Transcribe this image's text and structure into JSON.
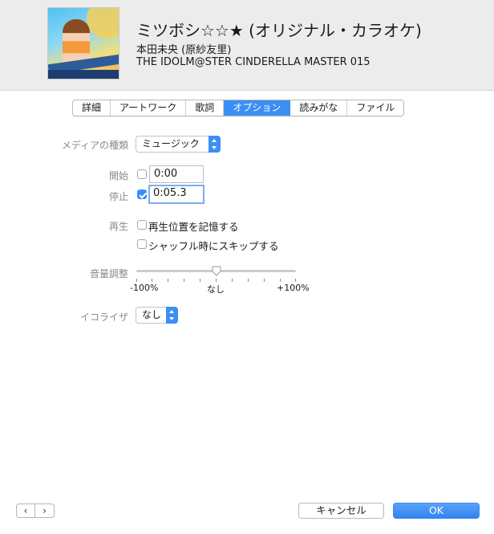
{
  "track": {
    "title": "ミツボシ☆☆★ (オリジナル・カラオケ)",
    "artist": "本田未央 (原紗友里)",
    "album": "THE IDOLM@STER CINDERELLA MASTER 015"
  },
  "tabs": [
    {
      "label": "詳細",
      "active": false
    },
    {
      "label": "アートワーク",
      "active": false
    },
    {
      "label": "歌詞",
      "active": false
    },
    {
      "label": "オプション",
      "active": true
    },
    {
      "label": "読みがな",
      "active": false
    },
    {
      "label": "ファイル",
      "active": false
    }
  ],
  "options": {
    "media_kind_label": "メディアの種類",
    "media_kind_value": "ミュージック",
    "start_label": "開始",
    "start_checked": false,
    "start_value": "0:00",
    "stop_label": "停止",
    "stop_checked": true,
    "stop_value": "0:05.3",
    "playback_label": "再生",
    "remember_position_label": "再生位置を記憶する",
    "remember_position_checked": false,
    "skip_shuffle_label": "シャッフル時にスキップする",
    "skip_shuffle_checked": false,
    "volume_label": "音量調整",
    "volume_adjust_percent": 0,
    "volume_min_label": "-100%",
    "volume_mid_label": "なし",
    "volume_max_label": "+100%",
    "equalizer_label": "イコライザ",
    "equalizer_value": "なし"
  },
  "footer": {
    "prev_icon": "‹",
    "next_icon": "›",
    "cancel_label": "キャンセル",
    "ok_label": "OK"
  },
  "colors": {
    "accent": "#3b8ff4",
    "header_bg": "#ececec"
  }
}
